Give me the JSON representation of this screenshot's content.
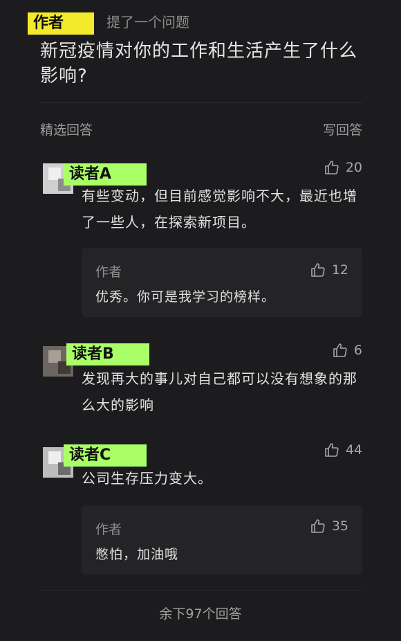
{
  "header": {
    "author_tag": "作者",
    "asked_text": "提了一个问题",
    "question": "新冠疫情对你的工作和生活产生了什么影响?"
  },
  "section": {
    "featured": "精选回答",
    "write": "写回答"
  },
  "answers": [
    {
      "name": "读者A",
      "likes": "20",
      "text": "有些变动，但目前感觉影响不大，最近也增了一些人，在探索新项目。",
      "reply": {
        "name": "作者",
        "likes": "12",
        "text": "优秀。你可是我学习的榜样。"
      }
    },
    {
      "name": "读者B",
      "likes": "6",
      "text": "发现再大的事儿对自己都可以没有想象的那么大的影响"
    },
    {
      "name": "读者C",
      "likes": "44",
      "text": "公司生存压力变大。",
      "reply": {
        "name": "作者",
        "likes": "35",
        "text": "憋怕，加油哦"
      }
    }
  ],
  "footer": {
    "more": "余下97个回答"
  },
  "icons": {
    "like": "thumbs-up-icon"
  },
  "colors": {
    "highlight_green": "#aaff66",
    "highlight_yellow": "#f3ea2c",
    "background": "#1c1c1e"
  }
}
